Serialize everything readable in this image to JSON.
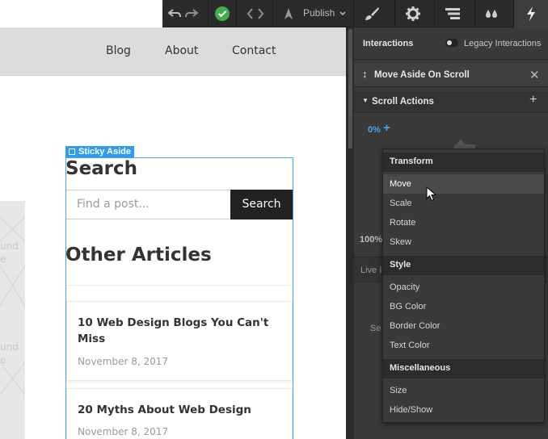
{
  "site": {
    "nav": [
      "Blog",
      "About",
      "Contact"
    ],
    "placeholder_lines": [
      "und",
      "e",
      "und",
      "e"
    ],
    "selection_tag": "Sticky Aside",
    "search_heading": "Search",
    "search_placeholder": "Find a post...",
    "search_button": "Search",
    "articles_heading": "Other Articles",
    "articles": [
      {
        "title": "10 Web Design Blogs You Can't Miss",
        "date": "November 8, 2017"
      },
      {
        "title": "20 Myths About Web Design",
        "date": "November 8, 2017"
      }
    ]
  },
  "toolbar": {
    "publish_label": "Publish",
    "icons": [
      "undo-icon",
      "redo-icon",
      "check-icon",
      "code-icon",
      "publish-icon",
      "brush-icon",
      "gear-icon",
      "navigator-icon",
      "drops-icon",
      "lightning-icon"
    ],
    "check_color": "#3fae4f"
  },
  "panel": {
    "interactions_title": "Interactions",
    "legacy_label": "Legacy Interactions",
    "interaction_name": "Move Aside On Scroll",
    "scroll_actions_label": "Scroll Actions",
    "pct_start": "0%",
    "pct_end": "100%",
    "live_label": "Live I",
    "se_label": "Se",
    "accent_color": "#4aa6f0"
  },
  "menu": {
    "sections": [
      {
        "title": "Transform",
        "items": [
          "Move",
          "Scale",
          "Rotate",
          "Skew"
        ]
      },
      {
        "title": "Style",
        "items": [
          "Opacity",
          "BG Color",
          "Border Color",
          "Text Color"
        ]
      },
      {
        "title": "Miscellaneous",
        "items": [
          "Size",
          "Hide/Show"
        ]
      }
    ],
    "hovered_item": "Move"
  }
}
